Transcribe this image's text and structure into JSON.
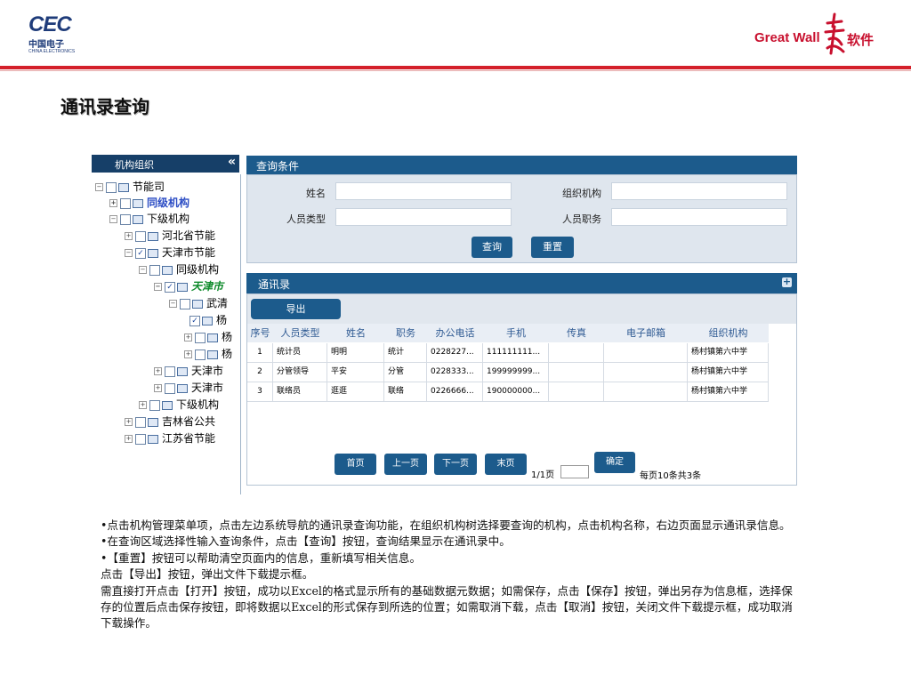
{
  "header": {
    "cec_logo": "CEC",
    "cec_cn": "中国电子",
    "cec_en": "CHINA ELECTRONICS",
    "greatwall_logo": "Great Wall",
    "greatwall_cn": "软件",
    "brand_red": "#d4202a",
    "brand_blue": "#1f3c7a"
  },
  "page_title": "通讯录查询",
  "tree": {
    "header_title": "机构组织",
    "collapse_symbol": "«",
    "nodes": [
      {
        "label": "节能司"
      },
      {
        "label": "同级机构"
      },
      {
        "label": "下级机构"
      },
      {
        "label": "河北省节能"
      },
      {
        "label": "天津市节能"
      },
      {
        "label": "同级机构"
      },
      {
        "label": "天津市"
      },
      {
        "label": "武清"
      },
      {
        "label": "杨"
      },
      {
        "label": "杨"
      },
      {
        "label": "杨"
      },
      {
        "label": "天津市"
      },
      {
        "label": "天津市"
      },
      {
        "label": "下级机构"
      },
      {
        "label": "吉林省公共"
      },
      {
        "label": "江苏省节能"
      }
    ]
  },
  "query": {
    "title": "查询条件",
    "name_label": "姓名",
    "org_label": "组织机构",
    "type_label": "人员类型",
    "position_label": "人员职务",
    "name_value": "",
    "org_value": "",
    "type_value": "",
    "position_value": "",
    "search_button": "查询",
    "reset_button": "重置"
  },
  "list": {
    "title": "通讯录",
    "expand_symbol": "+",
    "export_button": "导出",
    "columns": [
      "序号",
      "人员类型",
      "姓名",
      "职务",
      "办公电话",
      "手机",
      "传真",
      "电子邮箱",
      "组织机构"
    ],
    "rows": [
      [
        "1",
        "统计员",
        "明明",
        "统计",
        "0228227...",
        "111111111...",
        "",
        "",
        "杨村镇第六中学"
      ],
      [
        "2",
        "分管领导",
        "平安",
        "分管",
        "0228333...",
        "199999999...",
        "",
        "",
        "杨村镇第六中学"
      ],
      [
        "3",
        "联络员",
        "逛逛",
        "联络",
        "0226666...",
        "190000000...",
        "",
        "",
        "杨村镇第六中学"
      ]
    ]
  },
  "pager": {
    "first": "首页",
    "prev": "上一页",
    "next": "下一页",
    "last": "末页",
    "page_info": "1/1页",
    "page_input": "",
    "confirm": "确定",
    "summary": "每页10条共3条"
  },
  "description": [
    "•点击机构管理菜单项，点击左边系统导航的通讯录查询功能，在组织机构树选择要查询的机构，点击机构名称，右边页面显示通讯录信息。",
    "•在查询区域选择性输入查询条件，点击【查询】按钮，查询结果显示在通讯录中。",
    "•【重置】按钮可以帮助清空页面内的信息，重新填写相关信息。",
    "点击【导出】按钮，弹出文件下载提示框。",
    "需直接打开点击【打开】按钮，成功以Excel的格式显示所有的基础数据元数据；如需保存，点击【保存】按钮，弹出另存为信息框，选择保存的位置后点击保存按钮，即将数据以Excel的形式保存到所选的位置；如需取消下载，点击【取消】按钮，关闭文件下载提示框，成功取消下载操作。"
  ]
}
